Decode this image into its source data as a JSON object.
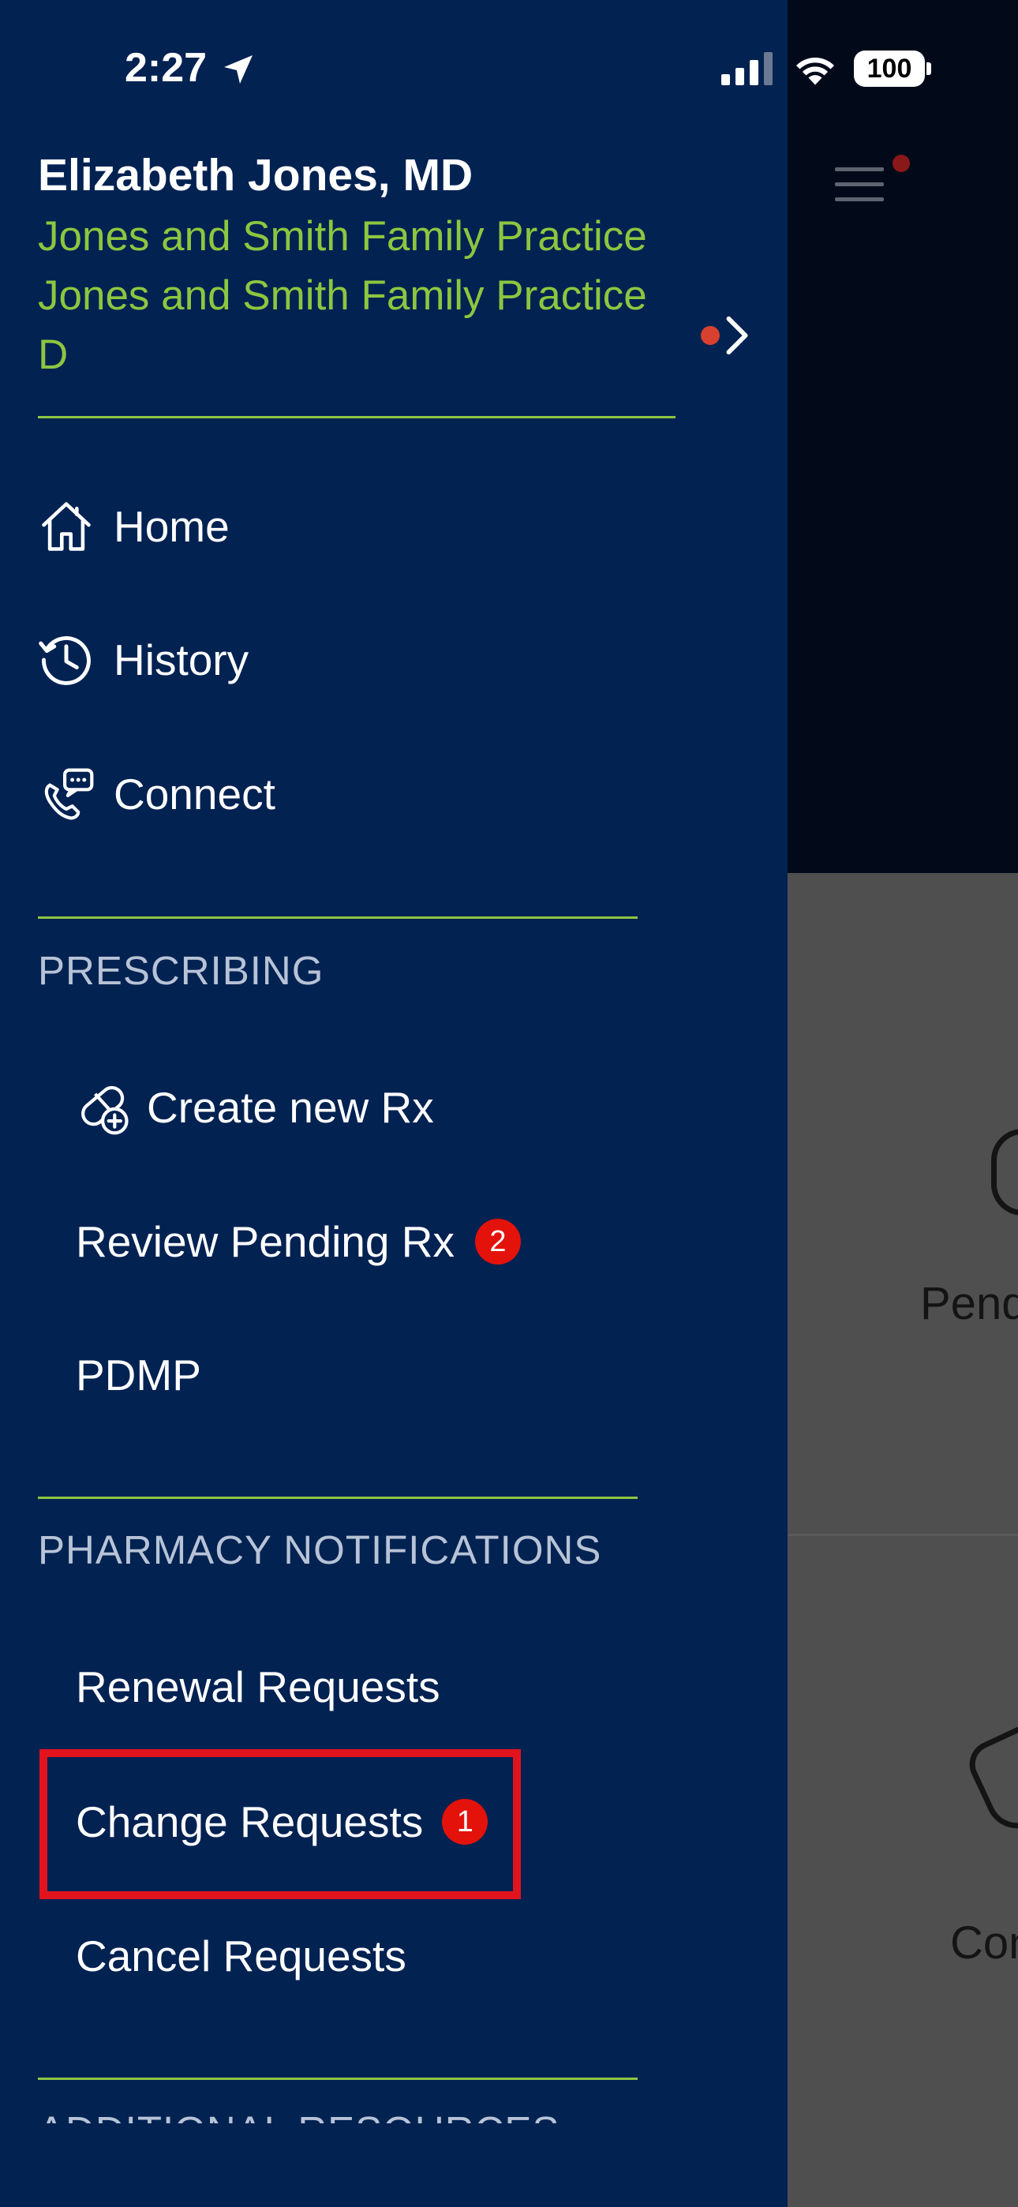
{
  "status_bar": {
    "time": "2:27",
    "battery": "100"
  },
  "profile": {
    "name": "Elizabeth Jones, MD",
    "practice_line_1": "Jones and Smith Family Practice",
    "practice_line_2": "Jones and Smith Family Practice",
    "practice_line_3": "D"
  },
  "nav": {
    "home": "Home",
    "history": "History",
    "connect": "Connect"
  },
  "prescribing": {
    "header": "PRESCRIBING",
    "create_rx": "Create new Rx",
    "review_pending": "Review Pending Rx",
    "review_pending_count": "2",
    "pdmp": "PDMP"
  },
  "pharmacy_notifications": {
    "header": "PHARMACY NOTIFICATIONS",
    "renewal": "Renewal Requests",
    "change": "Change Requests",
    "change_count": "1",
    "cancel": "Cancel Requests"
  },
  "additional_resources": {
    "header": "ADDITIONAL RESOURCES"
  },
  "background_app": {
    "card_1_label": "Pend",
    "card_2_label": "Con"
  },
  "colors": {
    "drawer_bg": "#022252",
    "accent_green": "#8dc63f",
    "badge_red": "#e3120b",
    "highlight_red": "#e1141e"
  }
}
